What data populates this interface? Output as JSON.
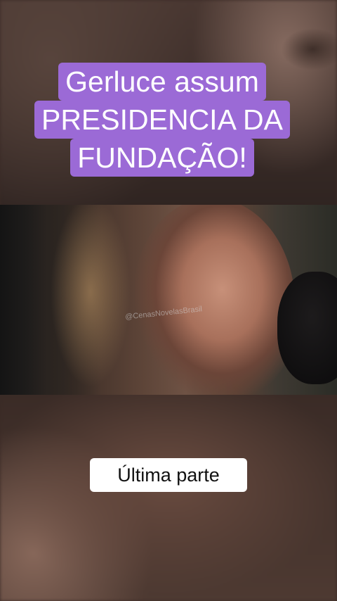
{
  "title_card": {
    "lines": [
      "Gerluce assum",
      "PRESIDENCIA DA",
      "FUNDAÇÃO!"
    ],
    "background_color": "#9b6ad6",
    "text_color": "#ffffff"
  },
  "video": {
    "watermark": "@CenasNovelasBrasil"
  },
  "caption": {
    "text": "Última parte",
    "background_color": "#ffffff"
  }
}
